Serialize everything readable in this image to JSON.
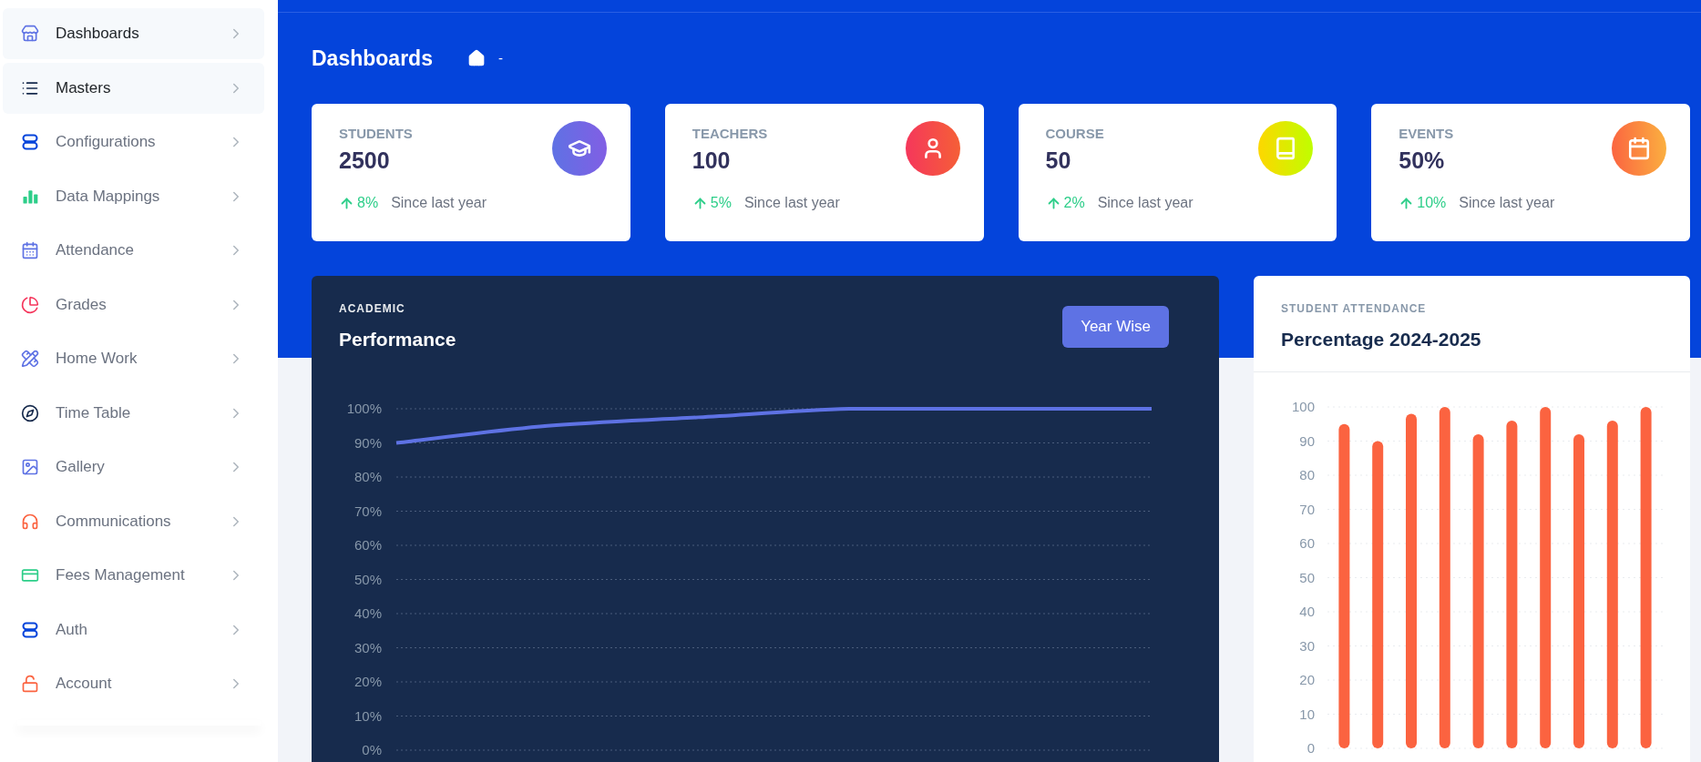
{
  "sidebar": {
    "items": [
      {
        "label": "Dashboards",
        "kind": "store",
        "selected": true
      },
      {
        "label": "Masters",
        "kind": "list",
        "selected": true
      },
      {
        "label": "Configurations",
        "kind": "toggles",
        "selected": false
      },
      {
        "label": "Data Mappings",
        "kind": "bars",
        "selected": false
      },
      {
        "label": "Attendance",
        "kind": "calendar",
        "selected": false
      },
      {
        "label": "Grades",
        "kind": "pie",
        "selected": false
      },
      {
        "label": "Home Work",
        "kind": "ruler",
        "selected": false
      },
      {
        "label": "Time Table",
        "kind": "compass",
        "selected": false
      },
      {
        "label": "Gallery",
        "kind": "image",
        "selected": false
      },
      {
        "label": "Communications",
        "kind": "headphones",
        "selected": false
      },
      {
        "label": "Fees Management",
        "kind": "card",
        "selected": false
      },
      {
        "label": "Auth",
        "kind": "toggles",
        "selected": false
      },
      {
        "label": "Account",
        "kind": "lock",
        "selected": false
      }
    ]
  },
  "header": {
    "title": "Dashboards",
    "breadcrumb": "-"
  },
  "stats": [
    {
      "label": "STUDENTS",
      "value": "2500",
      "change": "8%",
      "note": "Since last year",
      "kind": "graduate"
    },
    {
      "label": "TEACHERS",
      "value": "100",
      "change": "5%",
      "note": "Since last year",
      "kind": "person"
    },
    {
      "label": "COURSE",
      "value": "50",
      "change": "2%",
      "note": "Since last year",
      "kind": "book"
    },
    {
      "label": "EVENTS",
      "value": "50%",
      "change": "10%",
      "note": "Since last year",
      "kind": "calendar"
    }
  ],
  "performance": {
    "eyebrow": "ACADEMIC",
    "title": "Performance",
    "button": "Year Wise",
    "chart_data": {
      "type": "line",
      "grid": true,
      "ylim": [
        0,
        100
      ],
      "yticks": [
        {
          "value": 0,
          "label": "0%"
        },
        {
          "value": 10,
          "label": "10%"
        },
        {
          "value": 20,
          "label": "20%"
        },
        {
          "value": 30,
          "label": "30%"
        },
        {
          "value": 40,
          "label": "40%"
        },
        {
          "value": 50,
          "label": "50%"
        },
        {
          "value": 60,
          "label": "60%"
        },
        {
          "value": 70,
          "label": "70%"
        },
        {
          "value": 80,
          "label": "80%"
        },
        {
          "value": 90,
          "label": "90%"
        },
        {
          "value": 100,
          "label": "100%"
        }
      ],
      "series": [
        {
          "color": "#5e72e4",
          "values": [
            90,
            95,
            97.5,
            100,
            100,
            100
          ]
        }
      ]
    }
  },
  "attendance": {
    "eyebrow": "STUDENT ATTENDANCE",
    "title": "Percentage 2024-2025",
    "chart_data": {
      "type": "bar",
      "grid": true,
      "ylim": [
        0,
        100
      ],
      "yticks": [
        0,
        10,
        20,
        30,
        40,
        50,
        60,
        70,
        80,
        90,
        100
      ],
      "series": [
        {
          "color": "#fb6340",
          "values": [
            95,
            90,
            98,
            100,
            92,
            96,
            100,
            92,
            96,
            100
          ]
        }
      ]
    }
  }
}
